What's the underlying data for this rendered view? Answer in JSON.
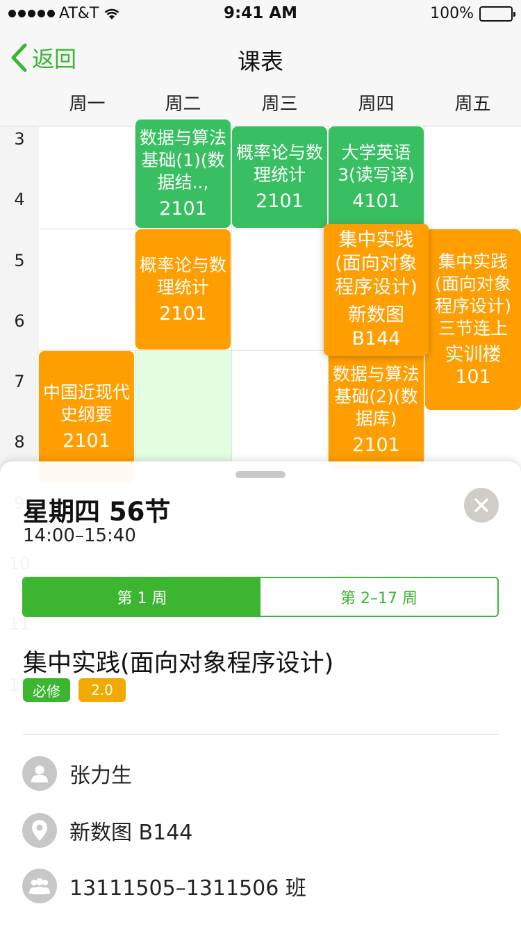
{
  "status_bar": {
    "carrier": "AT&T",
    "time": "9:41 AM",
    "battery": "100%"
  },
  "nav": {
    "back_label": "返回",
    "title": "课表"
  },
  "days": [
    "周一",
    "周二",
    "周三",
    "周四",
    "周五"
  ],
  "active_day": "周二",
  "periods": [
    "3",
    "4",
    "5",
    "6",
    "7",
    "8",
    "9",
    "10",
    "11",
    "12"
  ],
  "courses": {
    "tue_34": {
      "name": "数据与算法基础(1)(数据结..,",
      "room": "2101"
    },
    "wed_34": {
      "name": "概率论与数理统计",
      "room": "2101"
    },
    "thu_34": {
      "name": "大学英语3(读写译)",
      "room": "4101"
    },
    "tue_56": {
      "name": "概率论与数理统计",
      "room": "2101"
    },
    "thu_56": {
      "name": "集中实践(面向对象程序设计)",
      "room": "新数图B144"
    },
    "fri_567": {
      "name": "集中实践(面向对象程序设计)三节连上",
      "room": "实训楼101"
    },
    "mon_78": {
      "name": "中国近现代史纲要",
      "room": "2101"
    },
    "thu_78": {
      "name": "数据与算法基础(2)(数据库)",
      "room": "2101"
    }
  },
  "sheet": {
    "heading": "星期四 56节",
    "time_range": "14:00–15:40",
    "weeks": [
      "第 1 周",
      "第 2–17 周"
    ],
    "selected_week": "第 1 周",
    "course_name": "集中实践(面向对象程序设计)",
    "tags": {
      "type": "必修",
      "credit": "2.0"
    },
    "teacher": "张力生",
    "location": "新数图 B144",
    "classes": "13111505–1311506 班"
  },
  "colors": {
    "accent": "#3cb531",
    "course_green": "#38bf62",
    "course_orange": "#ff9e00",
    "credit_tag": "#f2a900"
  }
}
